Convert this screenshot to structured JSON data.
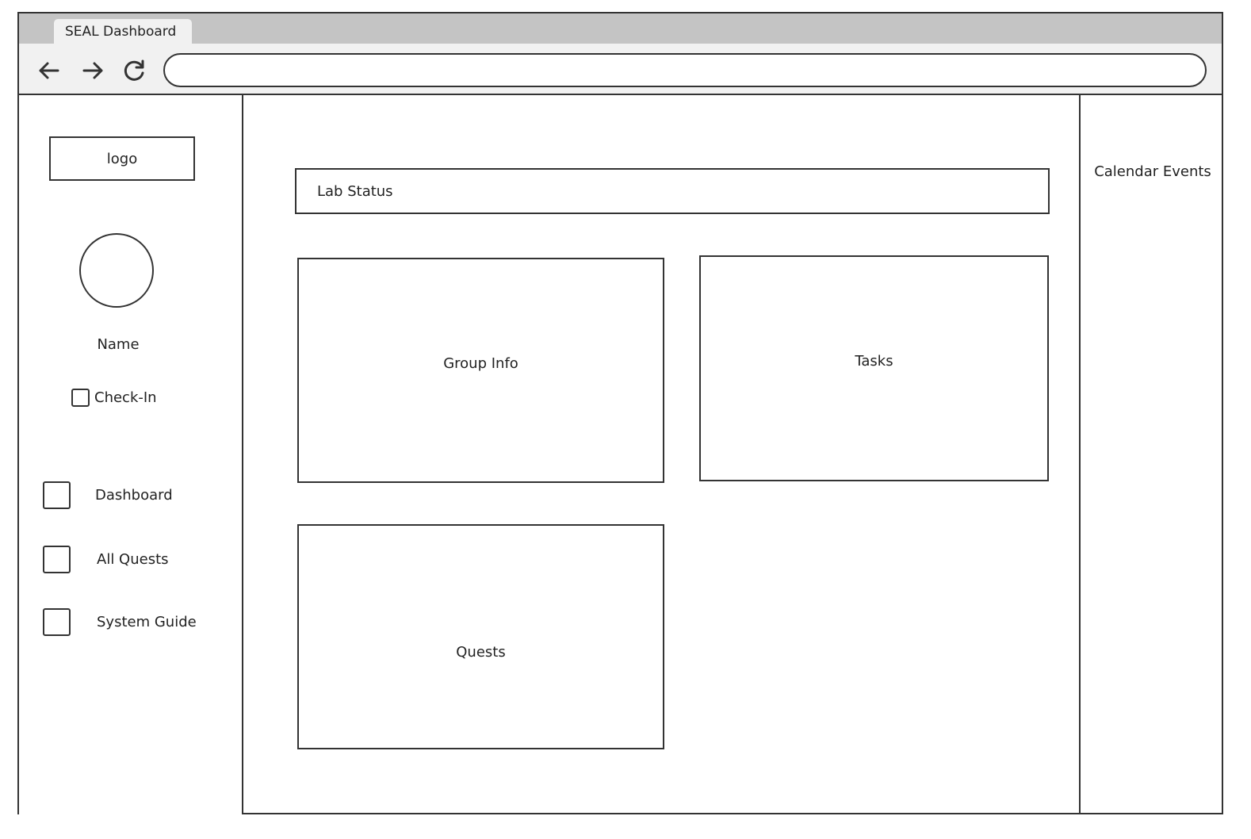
{
  "browser": {
    "tab_title": "SEAL Dashboard",
    "url": ""
  },
  "sidebar": {
    "logo_label": "logo",
    "user_name": "Name",
    "checkin_label": "Check-In",
    "items": [
      {
        "label": "Dashboard"
      },
      {
        "label": "All Quests"
      },
      {
        "label": "System Guide"
      }
    ]
  },
  "main": {
    "lab_status": "Lab Status",
    "group_info": "Group Info",
    "tasks": "Tasks",
    "quests": "Quests"
  },
  "right_panel": {
    "title": "Calendar Events"
  },
  "icons": {
    "back": "arrow-left-icon",
    "forward": "arrow-right-icon",
    "reload": "reload-icon"
  }
}
